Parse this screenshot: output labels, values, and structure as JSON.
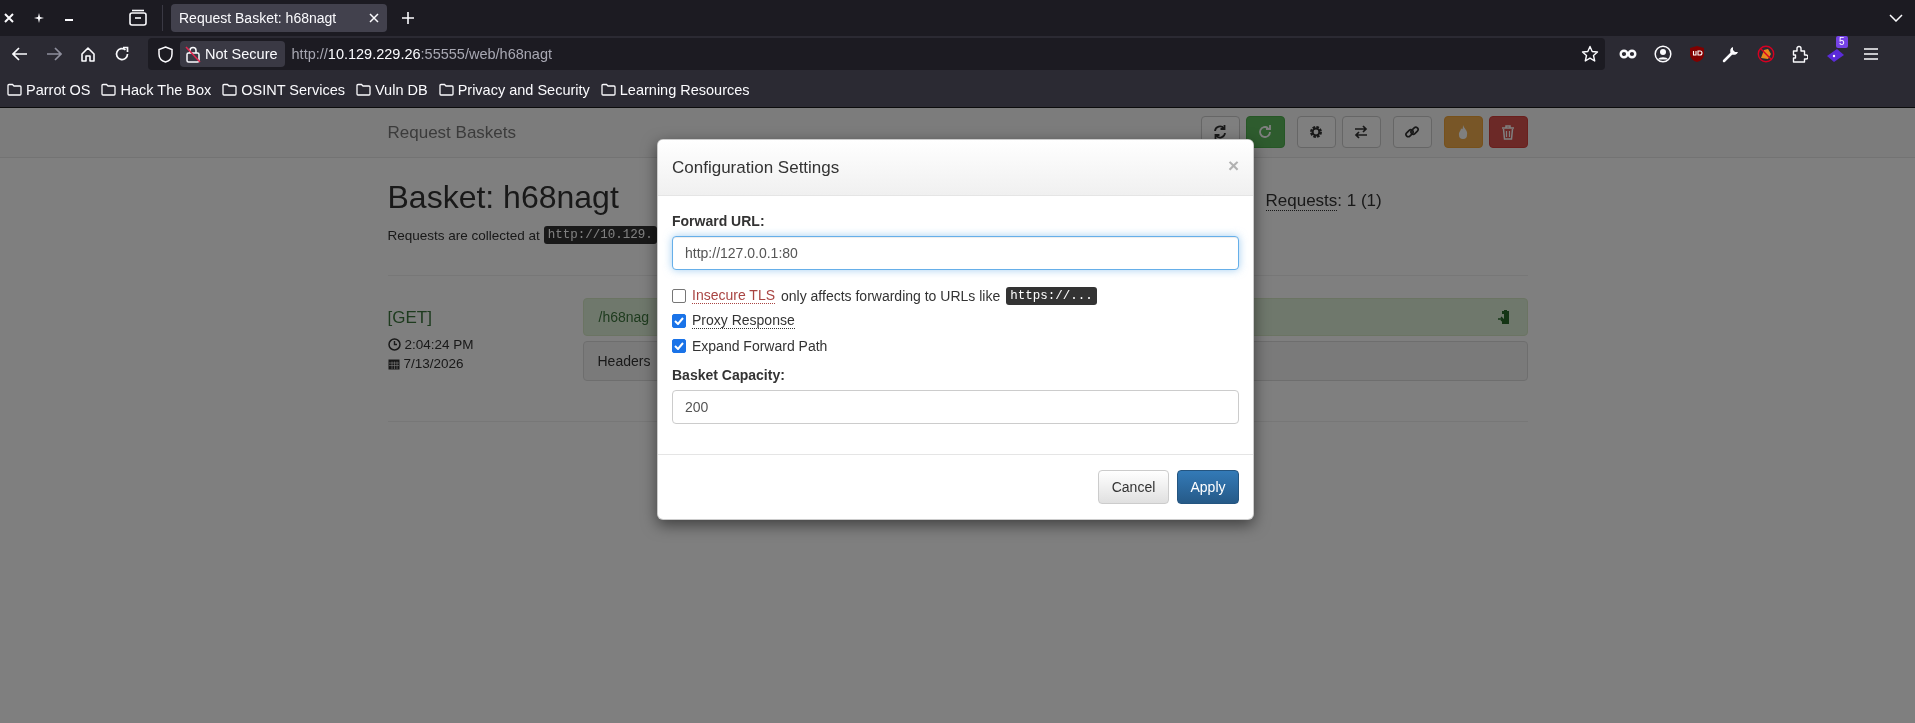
{
  "browser": {
    "tabs": [
      {
        "title": "Request Basket: h68nagt",
        "selected": true
      }
    ],
    "address_bar": {
      "security_label": "Not Secure",
      "url": {
        "scheme": "http://",
        "host": "10.129.229.26",
        "path": ":55555/web/h68nagt"
      }
    },
    "extension_badge": "5",
    "bookmarks": [
      {
        "label": "Parrot OS"
      },
      {
        "label": "Hack The Box"
      },
      {
        "label": "OSINT Services"
      },
      {
        "label": "Vuln DB"
      },
      {
        "label": "Privacy and Security"
      },
      {
        "label": "Learning Resources"
      }
    ]
  },
  "page": {
    "brand": "Request Baskets",
    "toolbar_groups": [
      {
        "buttons": [
          {
            "kind": "refresh"
          },
          {
            "kind": "auto-refresh"
          }
        ]
      },
      {
        "buttons": [
          {
            "kind": "settings"
          },
          {
            "kind": "responses"
          }
        ]
      },
      {
        "buttons": [
          {
            "kind": "link"
          }
        ]
      },
      {
        "buttons": [
          {
            "kind": "clear"
          },
          {
            "kind": "delete"
          }
        ]
      }
    ],
    "basket": {
      "title": "Basket: h68nagt",
      "collected_text": "Requests are collected at",
      "collected_url": "http://10.129.",
      "requests_label": "Requests",
      "requests_count": ": 1 (1)"
    },
    "requests": [
      {
        "method": "[GET]",
        "time": "2:04:24 PM",
        "date": "7/13/2026",
        "path": "/h68nag",
        "details_tab": "Headers"
      }
    ]
  },
  "modal": {
    "title": "Configuration Settings",
    "close": "×",
    "forward_url": {
      "label": "Forward URL:",
      "value": "http://127.0.0.1:80",
      "focused": true
    },
    "options": [
      {
        "kind": "warning",
        "label": "Insecure TLS",
        "note": "only affects forwarding to URLs like",
        "code": "https://...",
        "checked": false
      },
      {
        "kind": "hint",
        "label": "Proxy Response",
        "checked": true
      },
      {
        "kind": "plain",
        "label": "Expand Forward Path",
        "checked": true
      }
    ],
    "capacity": {
      "label": "Basket Capacity:",
      "value": "200"
    },
    "buttons": [
      {
        "label": "Cancel"
      },
      {
        "label": "Apply"
      }
    ]
  }
}
